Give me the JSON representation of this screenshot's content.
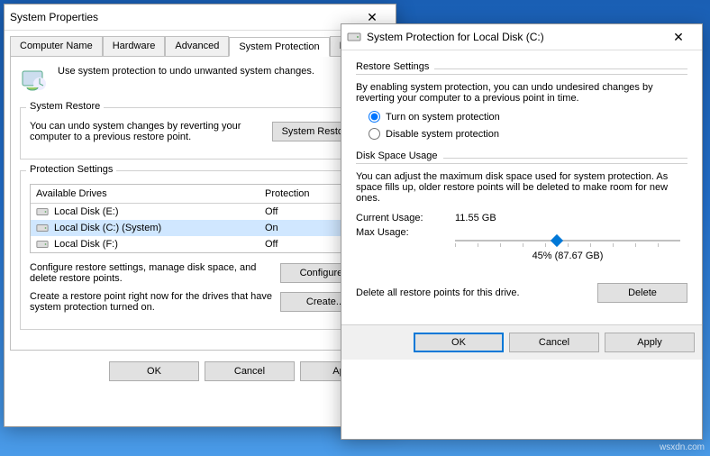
{
  "properties": {
    "title": "System Properties",
    "tabs": [
      "Computer Name",
      "Hardware",
      "Advanced",
      "System Protection",
      "Remote"
    ],
    "active_tab": 3,
    "intro": "Use system protection to undo unwanted system changes.",
    "restore": {
      "legend": "System Restore",
      "text": "You can undo system changes by reverting your computer to a previous restore point.",
      "button": "System Restore..."
    },
    "settings": {
      "legend": "Protection Settings",
      "cols": [
        "Available Drives",
        "Protection"
      ],
      "drives": [
        {
          "name": "Local Disk (E:)",
          "protection": "Off",
          "selected": false
        },
        {
          "name": "Local Disk (C:) (System)",
          "protection": "On",
          "selected": true
        },
        {
          "name": "Local Disk (F:)",
          "protection": "Off",
          "selected": false
        }
      ],
      "configure_text": "Configure restore settings, manage disk space, and delete restore points.",
      "configure_btn": "Configure...",
      "create_text": "Create a restore point right now for the drives that have system protection turned on.",
      "create_btn": "Create..."
    },
    "buttons": {
      "ok": "OK",
      "cancel": "Cancel",
      "apply": "Apply"
    }
  },
  "protection": {
    "title": "System Protection for Local Disk (C:)",
    "restore": {
      "legend": "Restore Settings",
      "text": "By enabling system protection, you can undo undesired changes by reverting your computer to a previous point in time.",
      "on_label": "Turn on system protection",
      "off_label": "Disable system protection",
      "selected": "on"
    },
    "usage": {
      "legend": "Disk Space Usage",
      "text": "You can adjust the maximum disk space used for system protection. As space fills up, older restore points will be deleted to make room for new ones.",
      "current_label": "Current Usage:",
      "current_value": "11.55 GB",
      "max_label": "Max Usage:",
      "percent_label": "45% (87.67 GB)",
      "slider_percent": 45
    },
    "delete": {
      "text": "Delete all restore points for this drive.",
      "button": "Delete"
    },
    "buttons": {
      "ok": "OK",
      "cancel": "Cancel",
      "apply": "Apply"
    }
  },
  "watermark": "wsxdn.com"
}
